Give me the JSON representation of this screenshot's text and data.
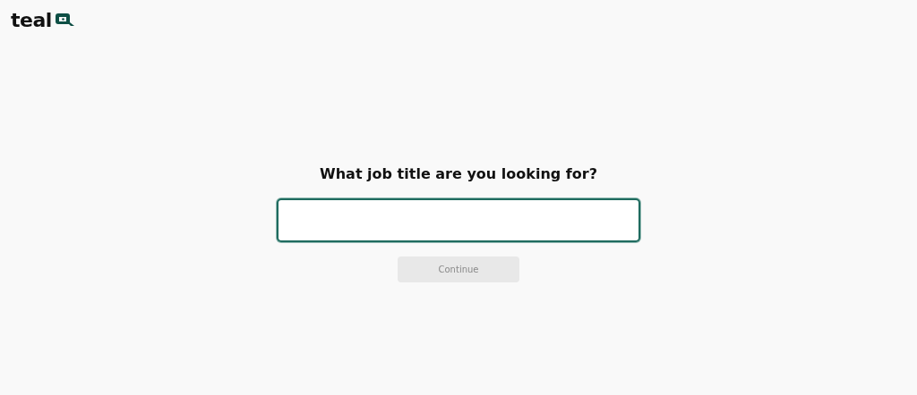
{
  "logo": {
    "text": "teal"
  },
  "question": "What job title are you looking for?",
  "job_title_field": {
    "focused": true
  },
  "continue_button": {
    "label": "Continue",
    "disabled": true
  }
}
